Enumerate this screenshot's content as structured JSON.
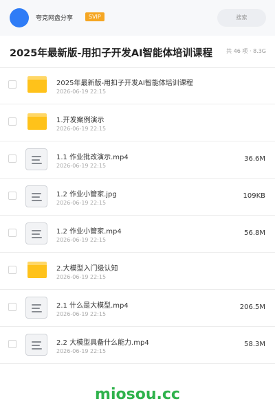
{
  "topbar": {
    "site_name": "夸克网盘分享",
    "badge": "SVIP",
    "search_placeholder": "搜索"
  },
  "header": {
    "title": "2025年最新版-用扣子开发AI智能体培训课程",
    "meta": "共 46 项 · 8.3G"
  },
  "files": [
    {
      "type": "folder",
      "name": "2025年最新版-用扣子开发AI智能体培训课程",
      "date": "2026-06-19 22:15",
      "size": ""
    },
    {
      "type": "folder",
      "name": "1.开发案例演示",
      "date": "2026-06-19 22:15",
      "size": ""
    },
    {
      "type": "file",
      "name": "1.1 作业批改演示.mp4",
      "date": "2026-06-19 22:15",
      "size": "36.6M"
    },
    {
      "type": "file",
      "name": "1.2 作业小管家.jpg",
      "date": "2026-06-19 22:15",
      "size": "109KB"
    },
    {
      "type": "file",
      "name": "1.2 作业小管家.mp4",
      "date": "2026-06-19 22:15",
      "size": "56.8M"
    },
    {
      "type": "folder",
      "name": "2.大模型入门级认知",
      "date": "2026-06-19 22:15",
      "size": ""
    },
    {
      "type": "file",
      "name": "2.1 什么是大模型.mp4",
      "date": "2026-06-19 22:15",
      "size": "206.5M"
    },
    {
      "type": "file",
      "name": "2.2 大模型具备什么能力.mp4",
      "date": "2026-06-19 22:15",
      "size": "58.3M"
    }
  ],
  "watermark": "miosou.cc",
  "colors": {
    "accent": "#2f7cf6",
    "folder": "#ffc21a",
    "svip": "#f5a623",
    "watermark": "#2fb24c"
  }
}
